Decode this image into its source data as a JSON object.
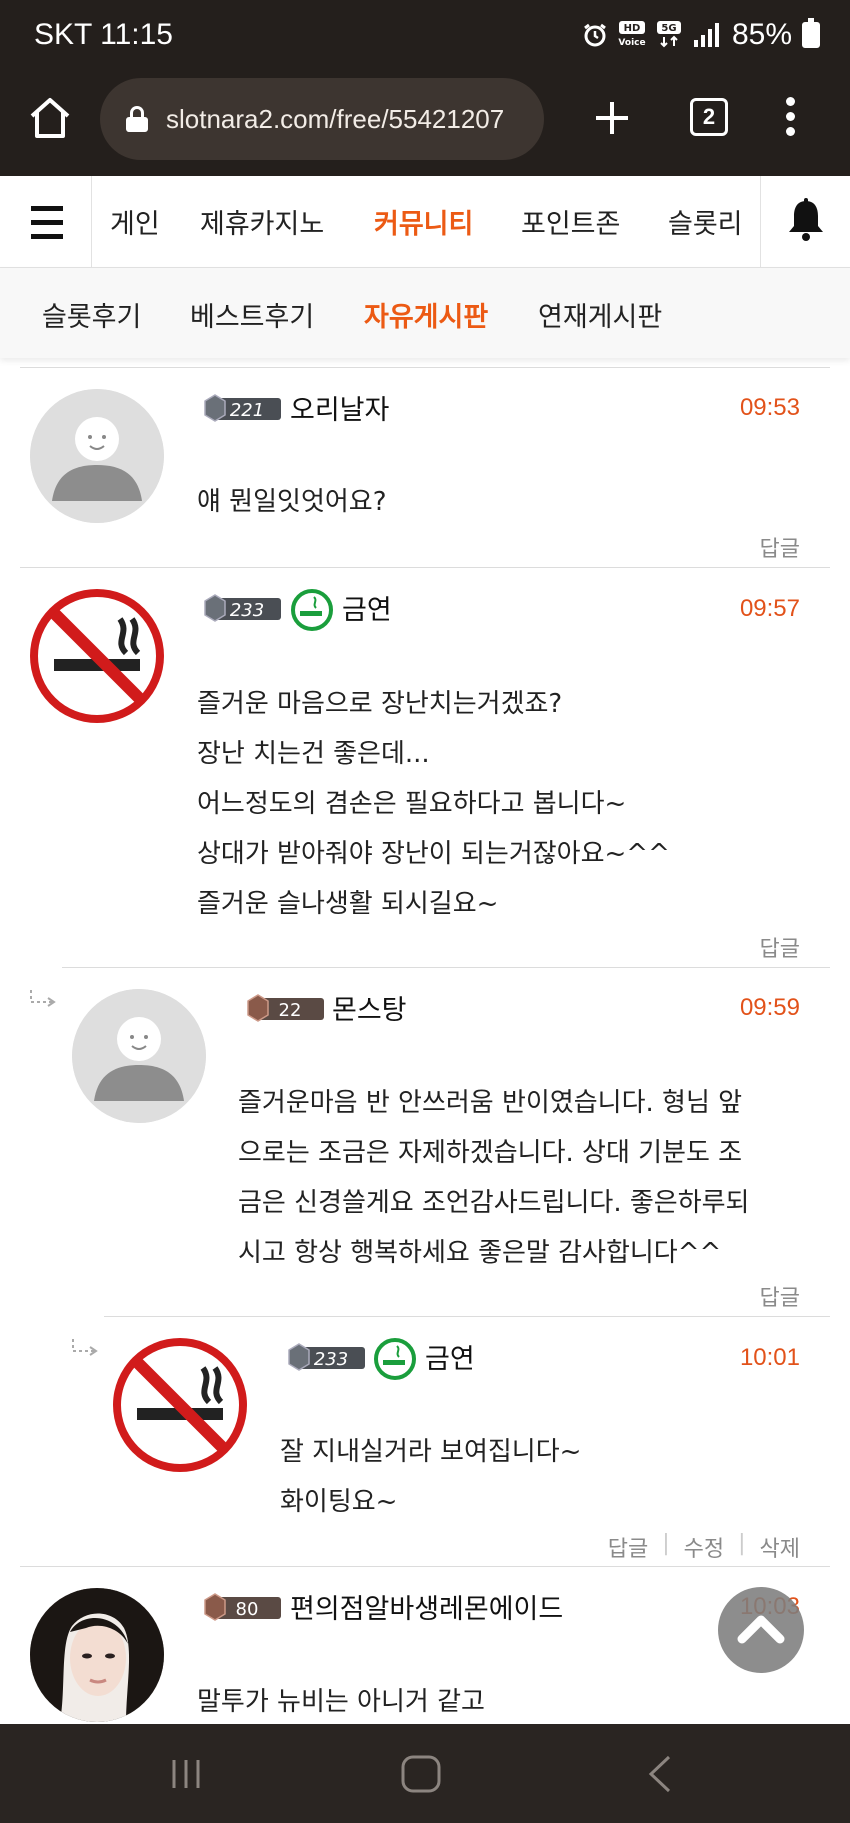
{
  "status_bar": {
    "carrier_time": "SKT 11:15",
    "battery": "85%",
    "icons": [
      "alarm-icon",
      "hd-voice-icon",
      "5g-icon",
      "signal-icon",
      "battery-icon"
    ]
  },
  "browser": {
    "url": "slotnara2.com/free/55421207",
    "tab_count": "2"
  },
  "site_nav": {
    "items": [
      {
        "label": "게인",
        "active": false
      },
      {
        "label": "제휴카지노",
        "active": false
      },
      {
        "label": "커뮤니티",
        "active": true
      },
      {
        "label": "포인트존",
        "active": false
      },
      {
        "label": "슬롯리",
        "active": false
      }
    ],
    "accent_color": "#ec5a14"
  },
  "sub_nav": {
    "items": [
      {
        "label": "슬롯후기",
        "active": false
      },
      {
        "label": "베스트후기",
        "active": false
      },
      {
        "label": "자유게시판",
        "active": true
      },
      {
        "label": "연재게시판",
        "active": false
      }
    ]
  },
  "comments": [
    {
      "level": "221",
      "username": "오리날자",
      "time": "09:53",
      "avatar": "default-avatar",
      "body": [
        "얘 뭔일잇엇어요?"
      ],
      "actions": [
        "답글"
      ]
    },
    {
      "level": "233",
      "username": "금연",
      "time": "09:57",
      "avatar": "no-smoking-avatar",
      "body": [
        "즐거운 마음으로 장난치는거겠죠?",
        "장난 치는건 좋은데...",
        "어느정도의 겸손은 필요하다고 봅니다~",
        "상대가 받아줘야 장난이 되는거잖아요~^^",
        "즐거운 슬나생활 되시길요~"
      ],
      "actions": [
        "답글"
      ]
    },
    {
      "level": "22",
      "username": "몬스탕",
      "time": "09:59",
      "avatar": "default-avatar",
      "reply": true,
      "body": [
        "즐거운마음 반 안쓰러움 반이였습니다. 형님 앞",
        "으로는 조금은 자제하겠습니다. 상대 기분도 조",
        "금은 신경쓸게요 조언감사드립니다. 좋은하루되",
        "시고 항상 행복하세요 좋은말 감사합니다^^"
      ],
      "actions": [
        "답글"
      ]
    },
    {
      "level": "233",
      "username": "금연",
      "time": "10:01",
      "avatar": "no-smoking-avatar",
      "reply": true,
      "body": [
        "잘 지내실거라 보여집니다~",
        "화이팅요~"
      ],
      "actions": [
        "답글",
        "수정",
        "삭제"
      ]
    },
    {
      "level": "80",
      "username": "편의점알바생레몬에이드",
      "time": "10:03",
      "avatar": "photo-avatar",
      "body": [
        "말투가 뉴비는 아니거 같고"
      ],
      "actions": []
    }
  ]
}
